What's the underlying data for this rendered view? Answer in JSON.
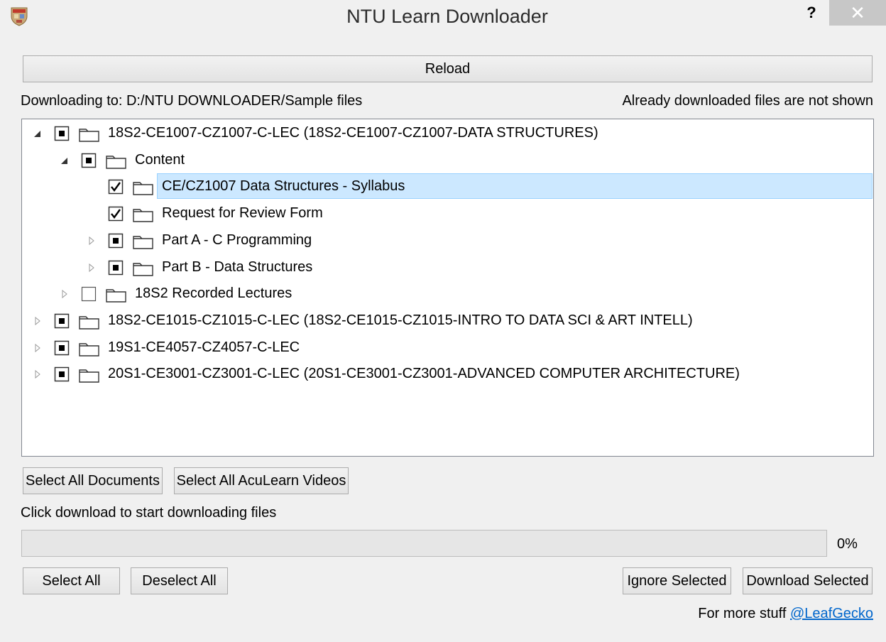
{
  "window": {
    "title": "NTU Learn Downloader",
    "help_label": "?",
    "close_label": "✕"
  },
  "toolbar": {
    "reload_label": "Reload"
  },
  "info": {
    "download_path": "Downloading to: D:/NTU DOWNLOADER/Sample files",
    "note": "Already downloaded files are not shown"
  },
  "tree": {
    "rows": [
      {
        "label": "18S2-CE1007-CZ1007-C-LEC (18S2-CE1007-CZ1007-DATA STRUCTURES)",
        "depth": 0,
        "expand": "expanded",
        "check": "partial",
        "selected": false
      },
      {
        "label": "Content",
        "depth": 1,
        "expand": "expanded",
        "check": "partial",
        "selected": false
      },
      {
        "label": "CE/CZ1007 Data Structures - Syllabus",
        "depth": 2,
        "expand": "none",
        "check": "checked",
        "selected": true
      },
      {
        "label": "Request for Review Form",
        "depth": 2,
        "expand": "none",
        "check": "checked",
        "selected": false
      },
      {
        "label": "Part A - C Programming",
        "depth": 2,
        "expand": "collapsed",
        "check": "partial",
        "selected": false
      },
      {
        "label": "Part B - Data Structures",
        "depth": 2,
        "expand": "collapsed",
        "check": "partial",
        "selected": false
      },
      {
        "label": "18S2 Recorded Lectures",
        "depth": 1,
        "expand": "collapsed",
        "check": "unchecked",
        "selected": false
      },
      {
        "label": "18S2-CE1015-CZ1015-C-LEC (18S2-CE1015-CZ1015-INTRO TO DATA SCI & ART INTELL)",
        "depth": 0,
        "expand": "collapsed",
        "check": "partial",
        "selected": false
      },
      {
        "label": "19S1-CE4057-CZ4057-C-LEC",
        "depth": 0,
        "expand": "collapsed",
        "check": "partial",
        "selected": false
      },
      {
        "label": "20S1-CE3001-CZ3001-C-LEC (20S1-CE3001-CZ3001-ADVANCED COMPUTER ARCHITECTURE)",
        "depth": 0,
        "expand": "collapsed",
        "check": "partial",
        "selected": false
      }
    ]
  },
  "filters": {
    "select_docs_label": "Select All Documents",
    "select_videos_label": "Select All AcuLearn Videos"
  },
  "status": {
    "message": "Click download to start downloading files",
    "progress": 0,
    "progress_label": "0%"
  },
  "actions": {
    "select_all_label": "Select All",
    "deselect_all_label": "Deselect All",
    "ignore_label": "Ignore Selected",
    "download_label": "Download Selected"
  },
  "footer": {
    "text": "For more stuff ",
    "link_label": "@LeafGecko"
  }
}
